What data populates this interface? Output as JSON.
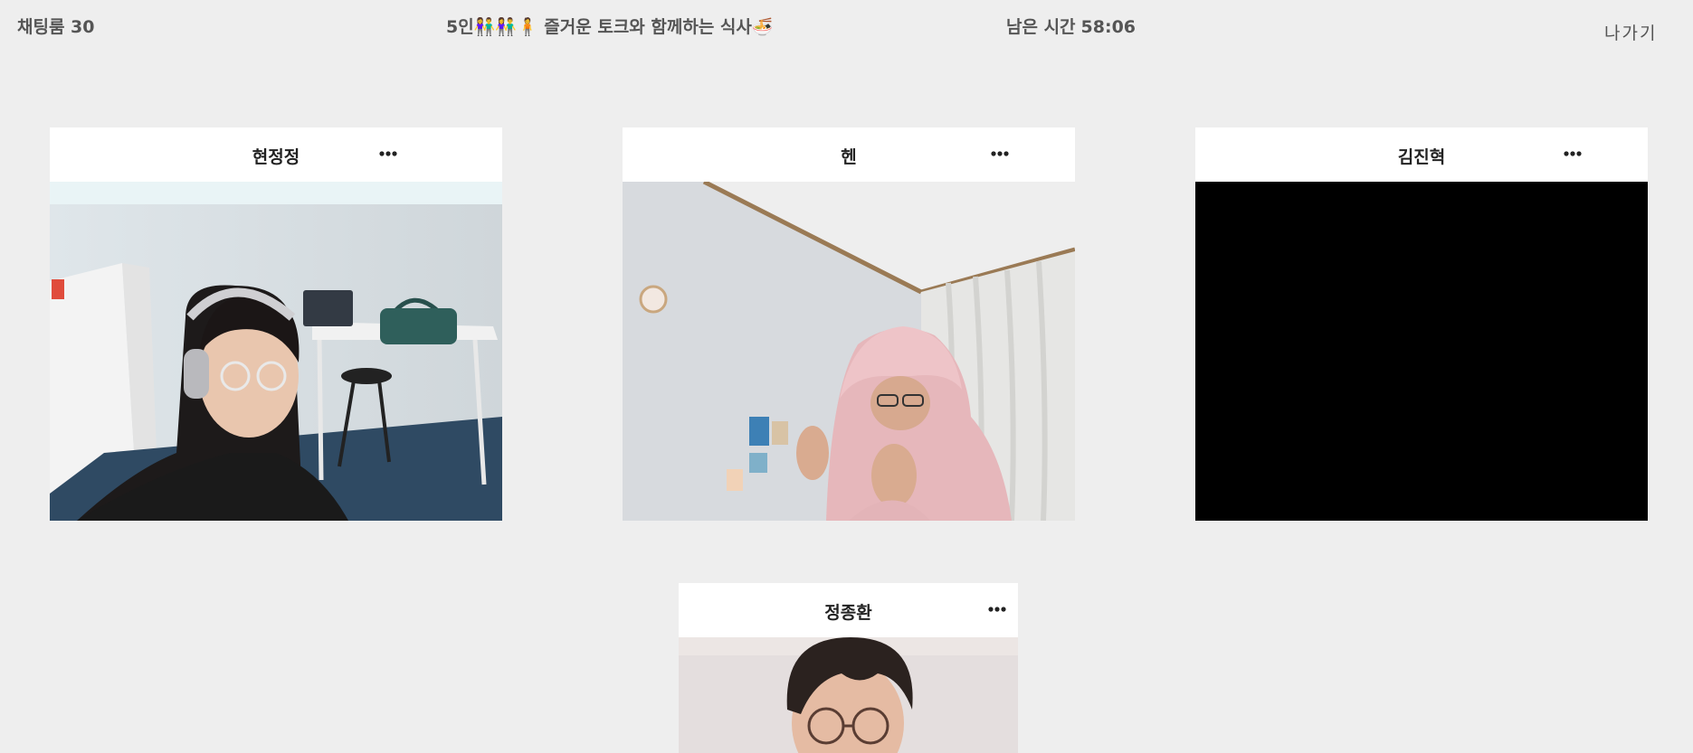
{
  "header": {
    "room_name": "채팅룸 30",
    "room_title": "5인👫👫🧍 즐거운 토크와 함께하는 식사🍜",
    "timer_label": "남은 시간",
    "timer_value": "58:06",
    "leave_label": "나가기"
  },
  "participants": [
    {
      "name": "현정정",
      "more_icon": "more-horizontal-icon",
      "video": "camera-on"
    },
    {
      "name": "헨",
      "more_icon": "more-horizontal-icon",
      "video": "camera-on"
    },
    {
      "name": "김진혁",
      "more_icon": "more-horizontal-icon",
      "video": "camera-off"
    },
    {
      "name": "정종환",
      "more_icon": "more-horizontal-icon",
      "video": "camera-on"
    }
  ],
  "colors": {
    "background": "#eeeeee",
    "tile": "#ffffff",
    "text": "#555555",
    "video_off": "#000000"
  }
}
